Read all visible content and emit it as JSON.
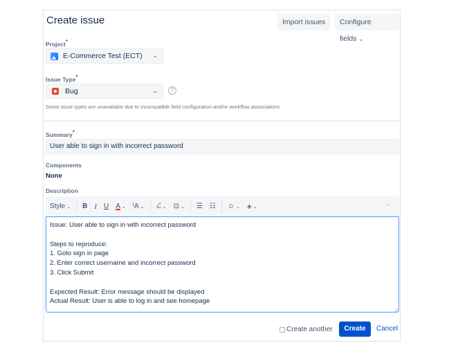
{
  "dialog": {
    "title": "Create issue",
    "import_label": "Import issues",
    "configure_label": "Configure fields",
    "chevron": "⌄"
  },
  "project": {
    "label": "Project",
    "required_mark": "*",
    "value": "E-Commerce Test (ECT)",
    "icon": "project-avatar-icon"
  },
  "issue_type": {
    "label": "Issue Type",
    "required_mark": "*",
    "value": "Bug",
    "icon": "bug-icon",
    "help": "?",
    "hint": "Some issue types are unavailable due to incompatible field configuration and/or workflow associations."
  },
  "summary": {
    "label": "Summary",
    "required_mark": "*",
    "value": "User able to sign in with incorrect password"
  },
  "components": {
    "label": "Components",
    "value": "None"
  },
  "description": {
    "label": "Description",
    "toolbar": {
      "style": "Style",
      "bold": "B",
      "italic": "I",
      "underline": "U",
      "text_color": "A",
      "text_effects": "ᵗA",
      "link": "🔗",
      "attachment": "⊡",
      "bullet_list": "☰",
      "numbered_list": "☷",
      "emoji": "☺",
      "insert": "+",
      "collapse": "⌃"
    },
    "value": "Issue: User able to sign in with incorrect password\n\nSteps to reproduce:\n1. Goto sign in page\n2. Enter correct username and incorrect password\n3. Click Submit\n\nExpected Result: Error message should be displayed\nActual Result: User is able to log in and see homepage"
  },
  "footer": {
    "create_another_label": "Create another",
    "create_another_checked": false,
    "create_label": "Create",
    "cancel_label": "Cancel"
  },
  "colors": {
    "primary": "#0052cc",
    "required": "#de350b",
    "focus_border": "#4c9aff",
    "bug": "#e5493a"
  }
}
